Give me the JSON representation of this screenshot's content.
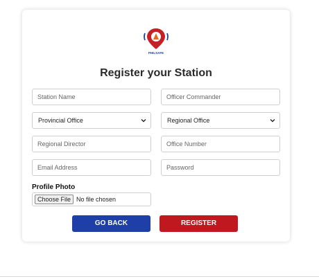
{
  "logo": {
    "text": "PHILSAFE"
  },
  "form": {
    "title": "Register your Station",
    "station_name_placeholder": "Station Name",
    "officer_commander_placeholder": "Officer Commander",
    "provincial_office_selected": "Provincial Office",
    "regional_office_selected": "Regional Office",
    "regional_director_placeholder": "Regional Director",
    "office_number_placeholder": "Office Number",
    "email_placeholder": "Email Address",
    "password_placeholder": "Password",
    "profile_photo_label": "Profile Photo",
    "choose_file_label": "Choose File",
    "no_file_text": "No file chosen",
    "go_back_label": "GO BACK",
    "register_label": "REGISTER"
  },
  "colors": {
    "primary_blue": "#1e3fa8",
    "primary_red": "#c0181f"
  }
}
